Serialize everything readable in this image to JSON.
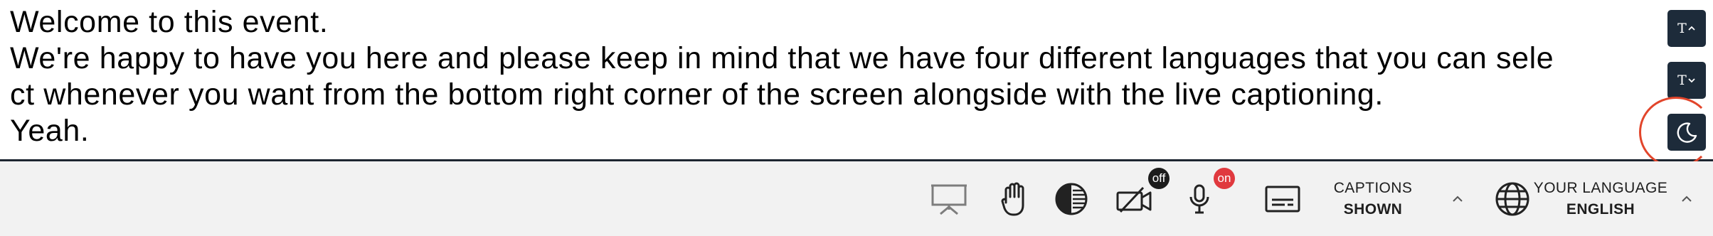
{
  "captions": {
    "lines": [
      "Welcome to this event.",
      "We're happy to have you here and please keep in mind that we have four different languages that you can sele",
      "ct whenever you want from the bottom right corner of the screen alongside with the live captioning.",
      "Yeah."
    ]
  },
  "side_controls": {
    "increase_text_label": "T",
    "decrease_text_label": "T",
    "increase_icon": "chevron-up-icon",
    "decrease_icon": "chevron-down-icon",
    "dark_mode_icon": "moon-icon"
  },
  "toolbar": {
    "presentation_icon": "presentation-icon",
    "raise_hand_icon": "hand-icon",
    "contrast_icon": "contrast-icon",
    "camera_icon": "camera-off-icon",
    "camera_badge": "off",
    "mic_icon": "microphone-icon",
    "mic_badge": "on",
    "captions_icon": "closed-captions-icon",
    "captions_top": "CAPTIONS",
    "captions_bottom": "SHOWN",
    "language_icon": "globe-icon",
    "language_top": "YOUR LANGUAGE",
    "language_bottom": "ENGLISH"
  },
  "colors": {
    "side_button_bg": "#1d2b3a",
    "toolbar_bg": "#f2f2f2",
    "badge_off": "#1c1c1c",
    "badge_on": "#e0393e",
    "highlight": "#e2452b"
  }
}
